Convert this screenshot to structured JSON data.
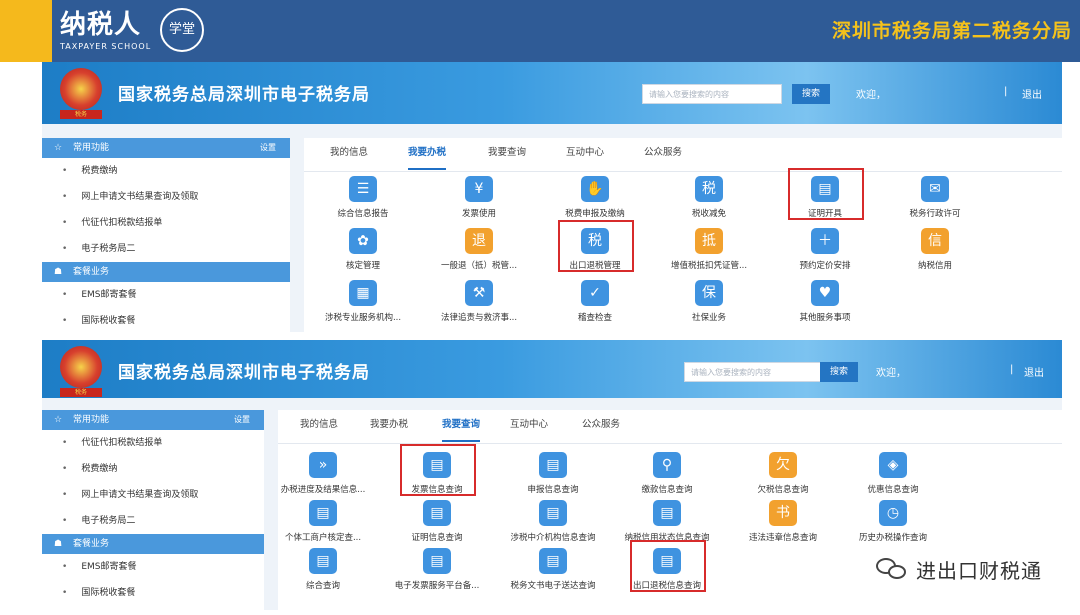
{
  "banner": {
    "logo_text": "纳税人",
    "logo_sub": "TAXPAYER SCHOOL",
    "logo_mark": "学堂",
    "bureau": "深圳市税务局第二税务分局"
  },
  "portal1": {
    "title": "国家税务总局深圳市电子税务局",
    "emblem_caption": "税务",
    "search_placeholder": "请输入您要搜索的内容",
    "search_button": "搜索",
    "welcome": "欢迎，",
    "separator": "|",
    "logout": "退出",
    "sidebar": {
      "section1": {
        "label": "常用功能",
        "setting": "设置"
      },
      "items1": [
        "税费缴纳",
        "网上申请文书结果查询及领取",
        "代征代扣税款结报单",
        "电子税务局二"
      ],
      "section2": {
        "label": "套餐业务"
      },
      "items2": [
        "EMS邮寄套餐",
        "国际税收套餐"
      ]
    },
    "tabs": [
      "我的信息",
      "我要办税",
      "我要查询",
      "互动中心",
      "公众服务"
    ],
    "active_tab": "我要办税",
    "icons": [
      {
        "label": "综合信息报告",
        "glyph": "☰",
        "color": "#3f93e0",
        "icon": "report-icon"
      },
      {
        "label": "发票使用",
        "glyph": "¥",
        "color": "#3f93e0",
        "icon": "invoice-icon"
      },
      {
        "label": "税费申报及缴纳",
        "glyph": "✋",
        "color": "#3f93e0",
        "icon": "declare-icon"
      },
      {
        "label": "税收减免",
        "glyph": "税",
        "color": "#3f93e0",
        "icon": "tax-relief-icon"
      },
      {
        "label": "证明开具",
        "glyph": "▤",
        "color": "#3f93e0",
        "icon": "certificate-icon",
        "highlight": true
      },
      {
        "label": "税务行政许可",
        "glyph": "✉",
        "color": "#3f93e0",
        "icon": "license-icon"
      },
      {
        "label": "核定管理",
        "glyph": "✿",
        "color": "#3f93e0",
        "icon": "assessment-icon"
      },
      {
        "label": "一般退（抵）税管...",
        "glyph": "退",
        "color": "#f2a12e",
        "icon": "refund-icon"
      },
      {
        "label": "出口退税管理",
        "glyph": "税",
        "color": "#3f93e0",
        "icon": "export-refund-icon",
        "highlight": true
      },
      {
        "label": "增值税抵扣凭证管...",
        "glyph": "抵",
        "color": "#f2a12e",
        "icon": "vat-deduction-icon"
      },
      {
        "label": "预约定价安排",
        "glyph": "＋",
        "color": "#3f93e0",
        "icon": "pricing-icon"
      },
      {
        "label": "纳税信用",
        "glyph": "信",
        "color": "#f2a12e",
        "icon": "credit-icon"
      },
      {
        "label": "涉税专业服务机构...",
        "glyph": "▦",
        "color": "#3f93e0",
        "icon": "agency-icon"
      },
      {
        "label": "法律追责与救济事...",
        "glyph": "⚒",
        "color": "#3f93e0",
        "icon": "law-icon"
      },
      {
        "label": "稽查检查",
        "glyph": "✓",
        "color": "#3f93e0",
        "icon": "inspection-icon"
      },
      {
        "label": "社保业务",
        "glyph": "保",
        "color": "#3f93e0",
        "icon": "social-security-icon"
      },
      {
        "label": "其他服务事项",
        "glyph": "♥",
        "color": "#3f93e0",
        "icon": "other-service-icon"
      }
    ]
  },
  "portal2": {
    "title": "国家税务总局深圳市电子税务局",
    "emblem_caption": "税务",
    "search_placeholder": "请输入您要搜索的内容",
    "search_button": "搜索",
    "welcome": "欢迎，",
    "separator": "|",
    "logout": "退出",
    "sidebar": {
      "section1": {
        "label": "常用功能",
        "setting": "设置"
      },
      "items1": [
        "代征代扣税款结报单",
        "税费缴纳",
        "网上申请文书结果查询及领取",
        "电子税务局二"
      ],
      "section2": {
        "label": "套餐业务"
      },
      "items2": [
        "EMS邮寄套餐",
        "国际税收套餐"
      ]
    },
    "tabs": [
      "我的信息",
      "我要办税",
      "我要查询",
      "互动中心",
      "公众服务"
    ],
    "active_tab": "我要查询",
    "icons": [
      {
        "label": "办税进度及结果信息...",
        "glyph": "»",
        "color": "#3f93e0",
        "icon": "progress-icon"
      },
      {
        "label": "发票信息查询",
        "glyph": "▤",
        "color": "#3f93e0",
        "icon": "invoice-query-icon",
        "highlight": true
      },
      {
        "label": "申报信息查询",
        "glyph": "▤",
        "color": "#3f93e0",
        "icon": "declare-query-icon"
      },
      {
        "label": "缴款信息查询",
        "glyph": "⚲",
        "color": "#3f93e0",
        "icon": "payment-query-icon"
      },
      {
        "label": "欠税信息查询",
        "glyph": "欠",
        "color": "#f2a12e",
        "icon": "arrears-query-icon"
      },
      {
        "label": "优惠信息查询",
        "glyph": "◈",
        "color": "#3f93e0",
        "icon": "preference-query-icon"
      },
      {
        "label": "个体工商户核定查...",
        "glyph": "▤",
        "color": "#3f93e0",
        "icon": "individual-query-icon"
      },
      {
        "label": "证明信息查询",
        "glyph": "▤",
        "color": "#3f93e0",
        "icon": "certificate-query-icon"
      },
      {
        "label": "涉税中介机构信息查询",
        "glyph": "▤",
        "color": "#3f93e0",
        "icon": "intermediary-query-icon"
      },
      {
        "label": "纳税信用状态信息查询",
        "glyph": "▤",
        "color": "#3f93e0",
        "icon": "credit-query-icon"
      },
      {
        "label": "违法违章信息查询",
        "glyph": "书",
        "color": "#f2a12e",
        "icon": "violation-query-icon"
      },
      {
        "label": "历史办税操作查询",
        "glyph": "◷",
        "color": "#3f93e0",
        "icon": "history-query-icon"
      },
      {
        "label": "综合查询",
        "glyph": "▤",
        "color": "#3f93e0",
        "icon": "general-query-icon"
      },
      {
        "label": "电子发票服务平台备...",
        "glyph": "▤",
        "color": "#3f93e0",
        "icon": "e-invoice-icon"
      },
      {
        "label": "税务文书电子送达查询",
        "glyph": "▤",
        "color": "#3f93e0",
        "icon": "document-delivery-icon"
      },
      {
        "label": "出口退税信息查询",
        "glyph": "▤",
        "color": "#3f93e0",
        "icon": "export-refund-query-icon",
        "highlight": true
      }
    ]
  },
  "watermark": {
    "text": "进出口财税通"
  }
}
